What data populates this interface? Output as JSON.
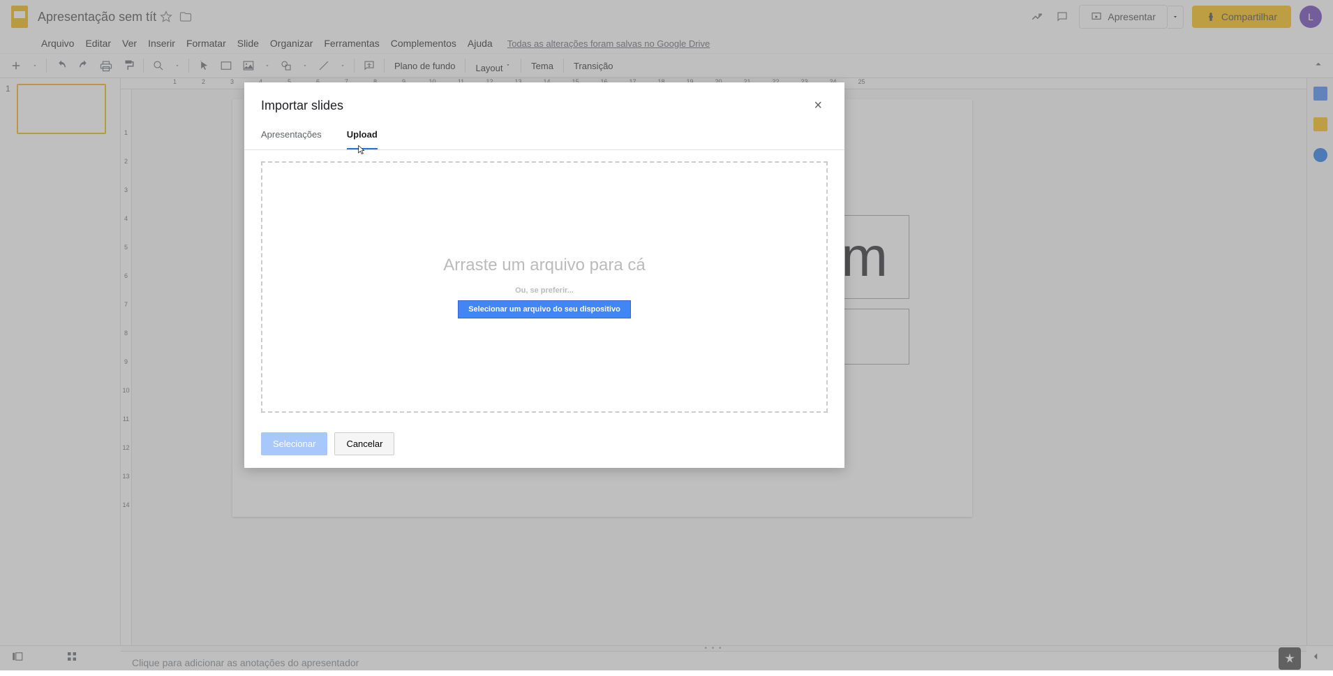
{
  "header": {
    "title": "Apresentação sem título",
    "present_label": "Apresentar",
    "share_label": "Compartilhar",
    "avatar_letter": "L"
  },
  "menubar": {
    "items": [
      "Arquivo",
      "Editar",
      "Ver",
      "Inserir",
      "Formatar",
      "Slide",
      "Organizar",
      "Ferramentas",
      "Complementos",
      "Ajuda"
    ],
    "save_status": "Todas as alterações foram salvas no Google Drive"
  },
  "toolbar": {
    "background_label": "Plano de fundo",
    "layout_label": "Layout",
    "theme_label": "Tema",
    "transition_label": "Transição"
  },
  "filmstrip": {
    "slides": [
      {
        "number": "1"
      }
    ]
  },
  "ruler_h": [
    "",
    "1",
    "2",
    "3",
    "4",
    "5",
    "6",
    "7",
    "8",
    "9",
    "10",
    "11",
    "12",
    "13",
    "14",
    "15",
    "16",
    "17",
    "18",
    "19",
    "20",
    "21",
    "22",
    "23",
    "24",
    "25"
  ],
  "ruler_v": [
    "",
    "1",
    "2",
    "3",
    "4",
    "5",
    "6",
    "7",
    "8",
    "9",
    "10",
    "11",
    "12",
    "13",
    "14"
  ],
  "canvas": {
    "partial_text": "m"
  },
  "notes": {
    "placeholder": "Clique para adicionar as anotações do apresentador"
  },
  "modal": {
    "title": "Importar slides",
    "tabs": [
      {
        "label": "Apresentações",
        "active": false
      },
      {
        "label": "Upload",
        "active": true
      }
    ],
    "dropzone": {
      "title": "Arraste um arquivo para cá",
      "or_text": "Ou, se preferir...",
      "button_label": "Selecionar um arquivo do seu dispositivo"
    },
    "footer": {
      "select_label": "Selecionar",
      "cancel_label": "Cancelar"
    }
  }
}
